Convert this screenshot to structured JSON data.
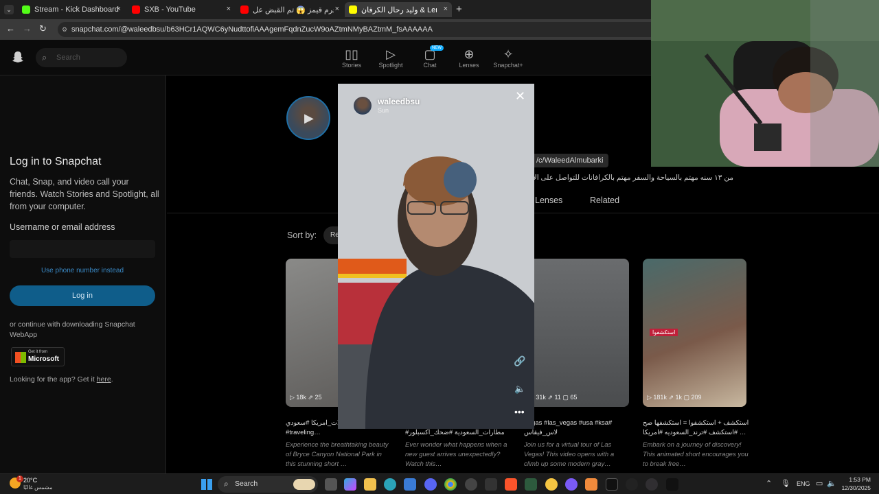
{
  "browser": {
    "tabs": [
      {
        "label": "Stream - Kick Dashboard",
        "close": "×"
      },
      {
        "label": "SXB - YouTube",
        "close": "×"
      },
      {
        "label": "نهاية مجرم قيمز 😱 تم القبض عل",
        "close": "×"
      },
      {
        "label": "وليد رحال الكرفان & Lenses",
        "close": "×"
      }
    ],
    "new_tab": "+",
    "url": "snapchat.com/@waleedbsu/b63HCr1AQWC6yNudttofiAAAgemFqdnZucW9oAZtmNMyBAZtmM_fsAAAAAA"
  },
  "snap_header": {
    "search_placeholder": "Search",
    "nav": [
      {
        "label": "Stories",
        "icon": "stories-icon"
      },
      {
        "label": "Spotlight",
        "icon": "spotlight-icon"
      },
      {
        "label": "Chat",
        "icon": "chat-icon",
        "badge": "NEW"
      },
      {
        "label": "Lenses",
        "icon": "lenses-icon"
      },
      {
        "label": "Snapchat+",
        "icon": "snapchat-plus-icon"
      }
    ]
  },
  "login": {
    "title": "Log in to Snapchat",
    "subtitle": "Chat, Snap, and video call your friends. Watch Stories and Spotlight, all from your computer.",
    "username_label": "Username or email address",
    "username_value": "",
    "phone_link": "Use phone number instead",
    "login_button": "Log in",
    "webapp_text": "or continue with downloading Snapchat WebApp",
    "ms_get": "Get it from",
    "ms_name": "Microsoft",
    "app_text": "Looking for the app? Get it",
    "app_link": "here"
  },
  "profile": {
    "youtube_link": "/c/WaleedAlmubarki",
    "bio": "من ١٣ سنه مهتم بالسياحة والسفر مهتم بالكرافانات للتواصل على الإيميل us",
    "tabs": [
      "Lenses",
      "Related"
    ],
    "sort_label": "Sort by:",
    "sort_value": "Re"
  },
  "cards": [
    {
      "stats": "▷ 18k  ⇗ 25",
      "title": "سبحان الخالق #رحلات_امريكا #سعودي #traveling…",
      "desc": "Experience the breathtaking beauty of Bryce Canyon National Park in this stunning short …"
    },
    {
      "stats": "",
      "title": "#مطارات_السعودية #ضحك_اكسبلور",
      "desc": "Ever wonder what happens when a new guest arrives unexpectedly? Watch this…"
    },
    {
      "stats": "▷ 31k  ⇗ 11  ▢ 65",
      "title": "Vegas #las_vegas #usa #ksa# لاس_فيقاس",
      "desc": "Join us for a virtual tour of Las Vegas! This video opens with a climb up some modern gray…"
    },
    {
      "stats": "▷ 181k  ⇗ 1k  ▢ 209",
      "title": "استكشف + استكشفوا = استكشفها صح #استكشف #ترند_السعوديه #امريكا …",
      "desc": "Embark on a journey of discovery! This animated short encourages you to break free…",
      "tag": "استكشفوا"
    }
  ],
  "story": {
    "username": "waleedbsu",
    "date": "Sun"
  },
  "taskbar": {
    "weather_temp": "20°C",
    "weather_desc": "مشمس غالبًا",
    "weather_badge": "1",
    "search_label": "Search",
    "lang": "ENG",
    "time": "1:53 PM",
    "date": "12/30/2025"
  }
}
